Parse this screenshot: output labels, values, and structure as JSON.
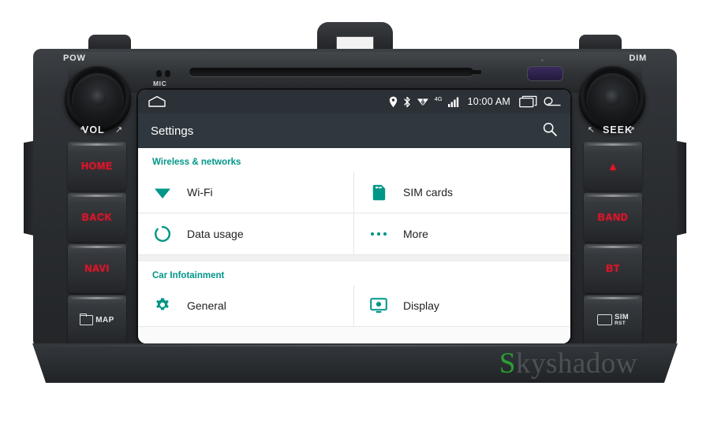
{
  "device": {
    "brand_watermark": "Skyshadow",
    "watermark_initial": "S",
    "watermark_rest": "kyshadow",
    "mic_label": "MIC",
    "power_knob_label": "POW",
    "dim_knob_label": "DIM",
    "volume_label": "VOL",
    "seek_label": "SEEK",
    "accent_red": "#e8142a",
    "accent_teal": "#009688",
    "left_arrow": "↖",
    "right_arrow": "↗"
  },
  "left_buttons": [
    {
      "label": "HOME",
      "name": "home-button",
      "style": "red"
    },
    {
      "label": "BACK",
      "name": "back-button",
      "style": "red"
    },
    {
      "label": "NAVI",
      "name": "navi-button",
      "style": "red"
    },
    {
      "label": "MAP",
      "name": "map-button",
      "style": "white-icon"
    }
  ],
  "right_buttons": [
    {
      "label": "▲",
      "name": "eject-button",
      "style": "eject"
    },
    {
      "label": "BAND",
      "name": "band-button",
      "style": "red"
    },
    {
      "label": "BT",
      "name": "bt-button",
      "style": "red"
    },
    {
      "label": "SIM",
      "sub": "RST",
      "name": "sim-reset-button",
      "style": "white-icon"
    }
  ],
  "statusbar": {
    "home_icon": "home-icon",
    "icons": [
      "location-pin-icon",
      "bluetooth-icon",
      "wifi-icon",
      "4g-label-icon",
      "signal-bars-icon"
    ],
    "network_label": "4G",
    "clock": "10:00 AM",
    "recents_icon": "recents-icon",
    "back_icon": "back-arrow-icon"
  },
  "actionbar": {
    "title": "Settings",
    "search_icon": "search-icon"
  },
  "settings": {
    "sections": [
      {
        "header": "Wireless & networks",
        "rows": [
          [
            {
              "label": "Wi-Fi",
              "icon": "wifi-icon"
            },
            {
              "label": "SIM cards",
              "icon": "sim-card-icon"
            }
          ],
          [
            {
              "label": "Data usage",
              "icon": "data-usage-icon"
            },
            {
              "label": "More",
              "icon": "more-dots-icon"
            }
          ]
        ]
      },
      {
        "header": "Car Infotainment",
        "rows": [
          [
            {
              "label": "General",
              "icon": "gear-icon"
            },
            {
              "label": "Display",
              "icon": "display-icon"
            }
          ]
        ]
      }
    ]
  }
}
